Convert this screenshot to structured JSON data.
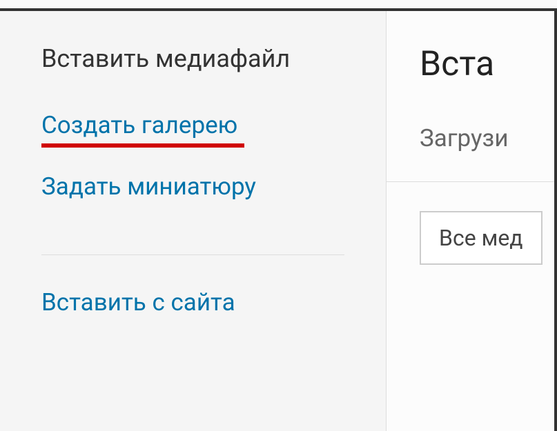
{
  "sidebar": {
    "title": "Вставить медиафайл",
    "items": [
      {
        "label": "Создать галерею"
      },
      {
        "label": "Задать миниатюру"
      },
      {
        "label": "Вставить с сайта"
      }
    ]
  },
  "main": {
    "heading": "Вста",
    "subheading": "Загрузи",
    "filter_label": "Все мед"
  }
}
